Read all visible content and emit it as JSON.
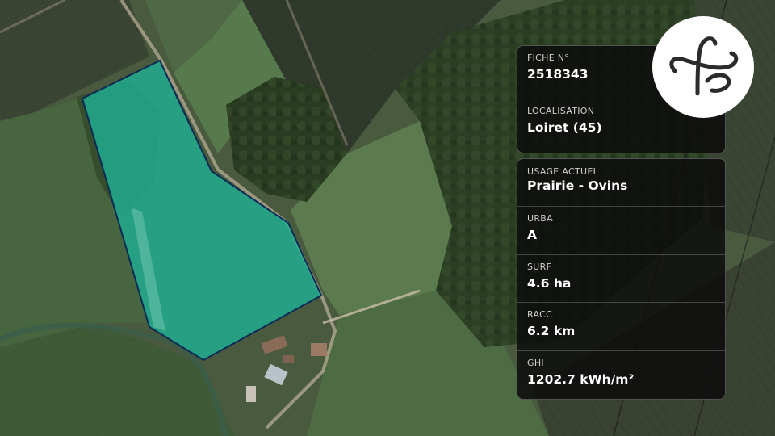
{
  "fiche": {
    "label": "FICHE N°",
    "value": "2518343"
  },
  "localisation": {
    "label": "LOCALISATION",
    "value": "Loiret (45)"
  },
  "details": [
    {
      "label": "USAGE ACTUEL",
      "value": "Prairie - Ovins"
    },
    {
      "label": "URBA",
      "value": "A"
    },
    {
      "label": "SURF",
      "value": "4.6 ha"
    },
    {
      "label": "RACC",
      "value": "6.2 km"
    },
    {
      "label": "GHI",
      "value": "1202.7 kWh/m²"
    }
  ],
  "logo": {
    "text": "fs",
    "icon": "fs-monogram-logo"
  },
  "colors": {
    "parcel_fill": "#1fae91",
    "parcel_outline": "#0b2a55",
    "card_bg": "#0c0c0c"
  }
}
